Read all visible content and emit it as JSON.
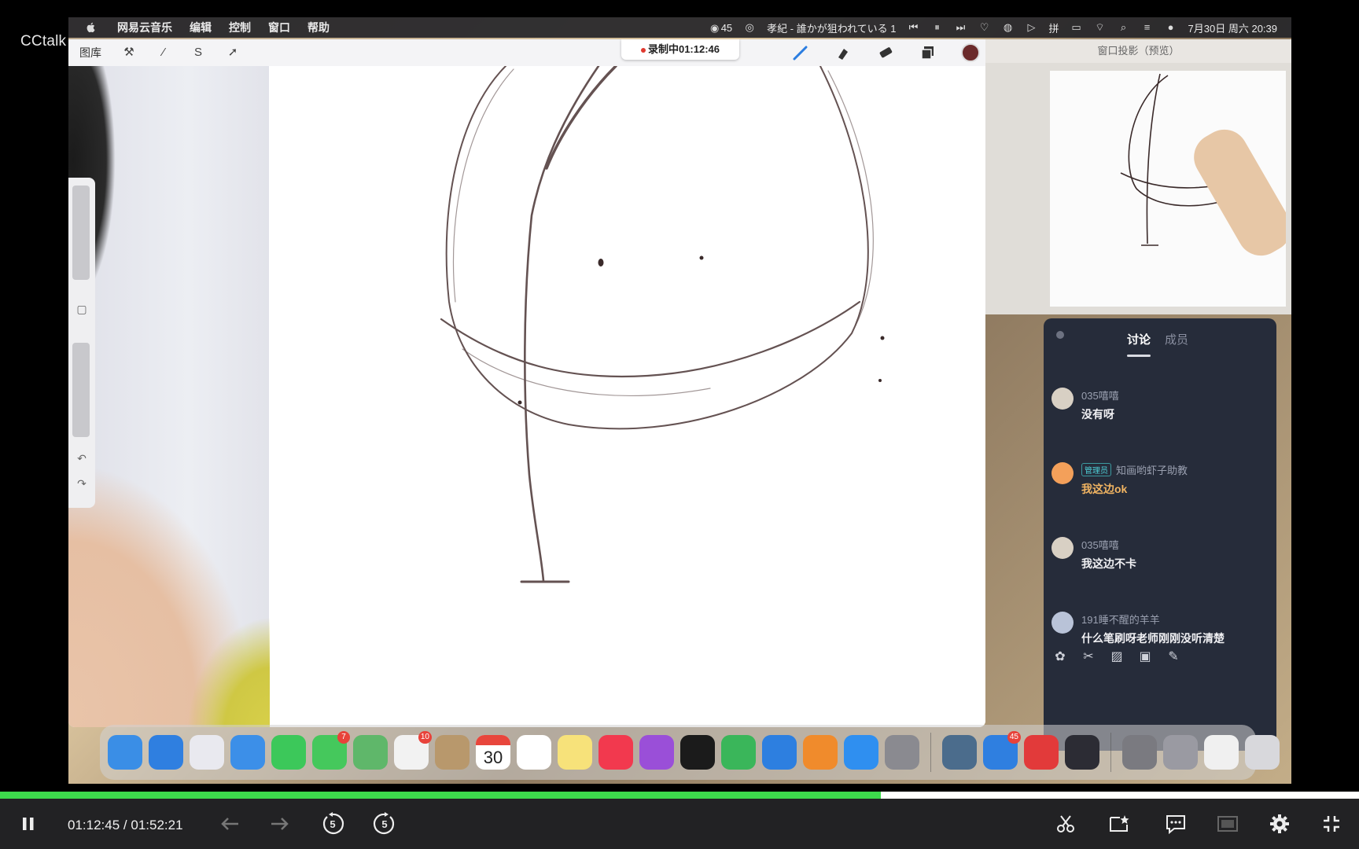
{
  "brand": "CCtalk",
  "menubar": {
    "app_name": "网易云音乐",
    "menus": [
      "编辑",
      "控制",
      "窗口",
      "帮助"
    ],
    "count_badge": "45",
    "now_playing": "孝紀 - 誰かが狙われている 1",
    "input_method": "拼",
    "datetime": "7月30日 周六 20:39"
  },
  "procreate": {
    "gallery_label": "图库",
    "recording_label": "录制中01:12:46",
    "current_color": "#6b2a2a"
  },
  "preview": {
    "title": "窗口投影（预览）"
  },
  "chat": {
    "tabs": [
      {
        "label": "讨论",
        "active": true
      },
      {
        "label": "成员",
        "active": false
      }
    ],
    "messages": [
      {
        "name": "035嘻嘻",
        "text": "没有呀",
        "badge": ""
      },
      {
        "name": "知画哟虾子助教",
        "text": "我这边ok",
        "badge": "管理员",
        "highlight": true
      },
      {
        "name": "035嘻嘻",
        "text": "我这边不卡",
        "badge": ""
      },
      {
        "name": "191睡不醒的羊羊",
        "text": "什么笔刷呀老师刚刚没听清楚",
        "badge": ""
      }
    ],
    "action_icons": [
      "flower-icon",
      "scissors-icon",
      "image-icon",
      "screen-share-icon",
      "edit-icon"
    ]
  },
  "dock": {
    "apps": [
      {
        "name": "finder",
        "color": "#3a8ee6"
      },
      {
        "name": "safari",
        "color": "#2f7fe0"
      },
      {
        "name": "launchpad",
        "color": "#e9e9ef"
      },
      {
        "name": "mail",
        "color": "#3c8fe8"
      },
      {
        "name": "facetime",
        "color": "#3cc85a"
      },
      {
        "name": "messages",
        "color": "#45c85c",
        "badge": "7"
      },
      {
        "name": "maps",
        "color": "#5fb76a"
      },
      {
        "name": "photos",
        "color": "#f2f2f2",
        "badge": "10"
      },
      {
        "name": "contacts",
        "color": "#b8986c"
      },
      {
        "name": "calendar",
        "color": "#ffffff",
        "day": "30"
      },
      {
        "name": "reminders",
        "color": "#ffffff"
      },
      {
        "name": "notes",
        "color": "#f7e27a"
      },
      {
        "name": "music",
        "color": "#f2394e"
      },
      {
        "name": "podcasts",
        "color": "#9a4fd8"
      },
      {
        "name": "apple-tv",
        "color": "#1b1b1b"
      },
      {
        "name": "numbers",
        "color": "#3ab65a"
      },
      {
        "name": "keynote",
        "color": "#2d7fe0"
      },
      {
        "name": "pages",
        "color": "#f08b2c"
      },
      {
        "name": "app-store",
        "color": "#2f8ff0"
      },
      {
        "name": "system-preferences",
        "color": "#8a8a90"
      },
      {
        "name": "quicktime",
        "color": "#4b6c8c"
      },
      {
        "name": "cctalk",
        "color": "#2f7fe0",
        "badge": "45"
      },
      {
        "name": "netease-music",
        "color": "#e23a3a"
      },
      {
        "name": "obs",
        "color": "#2c2c34"
      },
      {
        "name": "window-thumb-1",
        "color": "#7a7a80"
      },
      {
        "name": "window-thumb-2",
        "color": "#9a9aa2"
      },
      {
        "name": "window-thumb-3",
        "color": "#f0f0f0"
      },
      {
        "name": "trash",
        "color": "#d8d8dc"
      }
    ]
  },
  "player": {
    "current_time": "01:12:45",
    "separator": "/",
    "total_time": "01:52:21",
    "progress": 0.648,
    "rewind_seconds": "5",
    "forward_seconds": "5"
  }
}
